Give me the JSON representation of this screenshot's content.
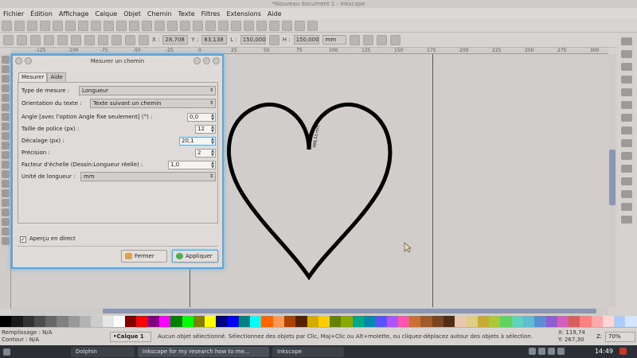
{
  "window": {
    "title": "*Nouveau document 1 - Inkscape"
  },
  "menu": [
    "Fichier",
    "Édition",
    "Affichage",
    "Calque",
    "Objet",
    "Chemin",
    "Texte",
    "Filtres",
    "Extensions",
    "Aide"
  ],
  "controls": {
    "x_label": "X :",
    "x_value": "28,708",
    "y_label": "Y :",
    "y_value": "83,138",
    "w_label": "L :",
    "w_value": "150,000",
    "h_label": "H :",
    "h_value": "150,000",
    "unit": "mm"
  },
  "ruler_ticks": [
    "-125",
    "-100",
    "-75",
    "-50",
    "-25",
    "0",
    "25",
    "50",
    "75",
    "100",
    "125",
    "150",
    "175",
    "200",
    "225",
    "250",
    "275",
    "300"
  ],
  "dialog": {
    "title": "Mesurer un chemin",
    "tabs": [
      "Mesurer",
      "Aide"
    ],
    "measure_type_label": "Type de mesure :",
    "measure_type_value": "Longueur",
    "text_orientation_label": "Orientation du texte :",
    "text_orientation_value": "Texte suivant un chemin",
    "angle_label": "Angle [avec l'option Angle fixe seulement] (°) :",
    "angle_value": "0,0",
    "font_size_label": "Taille de police (px) :",
    "font_size_value": "12",
    "offset_label": "Décalage (px) :",
    "offset_value": "20,1",
    "precision_label": "Précision :",
    "precision_value": "2",
    "scale_label": "Facteur d'échelle (Dessin:Longueur réelle) :",
    "scale_value": "1,0",
    "unit_label": "Unité de longueur :",
    "unit_value": "mm",
    "live_preview_label": "Aperçu en direct",
    "live_preview_checked": true,
    "close_label": "Fermer",
    "apply_label": "Appliquer"
  },
  "canvas": {
    "measure_text": "488,53 mm"
  },
  "status": {
    "fill_label": "Remplissage :",
    "fill_value": "N/A",
    "stroke_label": "Contour :",
    "stroke_value": "N/A",
    "layer": "•Calque 1",
    "message": "Aucun objet sélectionné. Sélectionnez des objets par Clic, Maj+Clic ou Alt+molette, ou cliquez-déplacez autour des objets à sélection.",
    "x_label": "X:",
    "x_value": "119,74",
    "y_label": "Y:",
    "y_value": "267,30",
    "z_label": "Z:",
    "zoom": "70%"
  },
  "taskbar": {
    "items": [
      "Dolphin",
      "Inkscape for my research how to me...",
      "Inkscape"
    ],
    "clock": "14:49"
  },
  "colors": {
    "dialog_border": "#5aa7df",
    "scroll_thumb": "#8b96b3",
    "palette": [
      "#000000",
      "#1a1a1a",
      "#333333",
      "#4d4d4d",
      "#666666",
      "#808080",
      "#999999",
      "#b3b3b3",
      "#cccccc",
      "#e6e6e6",
      "#ffffff",
      "#800000",
      "#ff0000",
      "#800080",
      "#ff00ff",
      "#008000",
      "#00ff00",
      "#808000",
      "#ffff00",
      "#000080",
      "#0000ff",
      "#008080",
      "#00ffff",
      "#ff6600",
      "#ff9955",
      "#aa4400",
      "#552200",
      "#d4aa00",
      "#ffcc00",
      "#668000",
      "#88aa00",
      "#00aa88",
      "#0088aa",
      "#5555ff",
      "#aa55ff",
      "#ff55aa",
      "#c87137",
      "#a05a2c",
      "#784421",
      "#502d16",
      "#e9c6af",
      "#decd87",
      "#c8ab37",
      "#abc837",
      "#5fd35f",
      "#5fd3bc",
      "#5fbcd3",
      "#5f8dd3",
      "#8d5fd3",
      "#d35fbc",
      "#d35f5f",
      "#ff8080",
      "#ffaaaa",
      "#ffd5d5",
      "#aaccff",
      "#d5e5ff"
    ]
  }
}
